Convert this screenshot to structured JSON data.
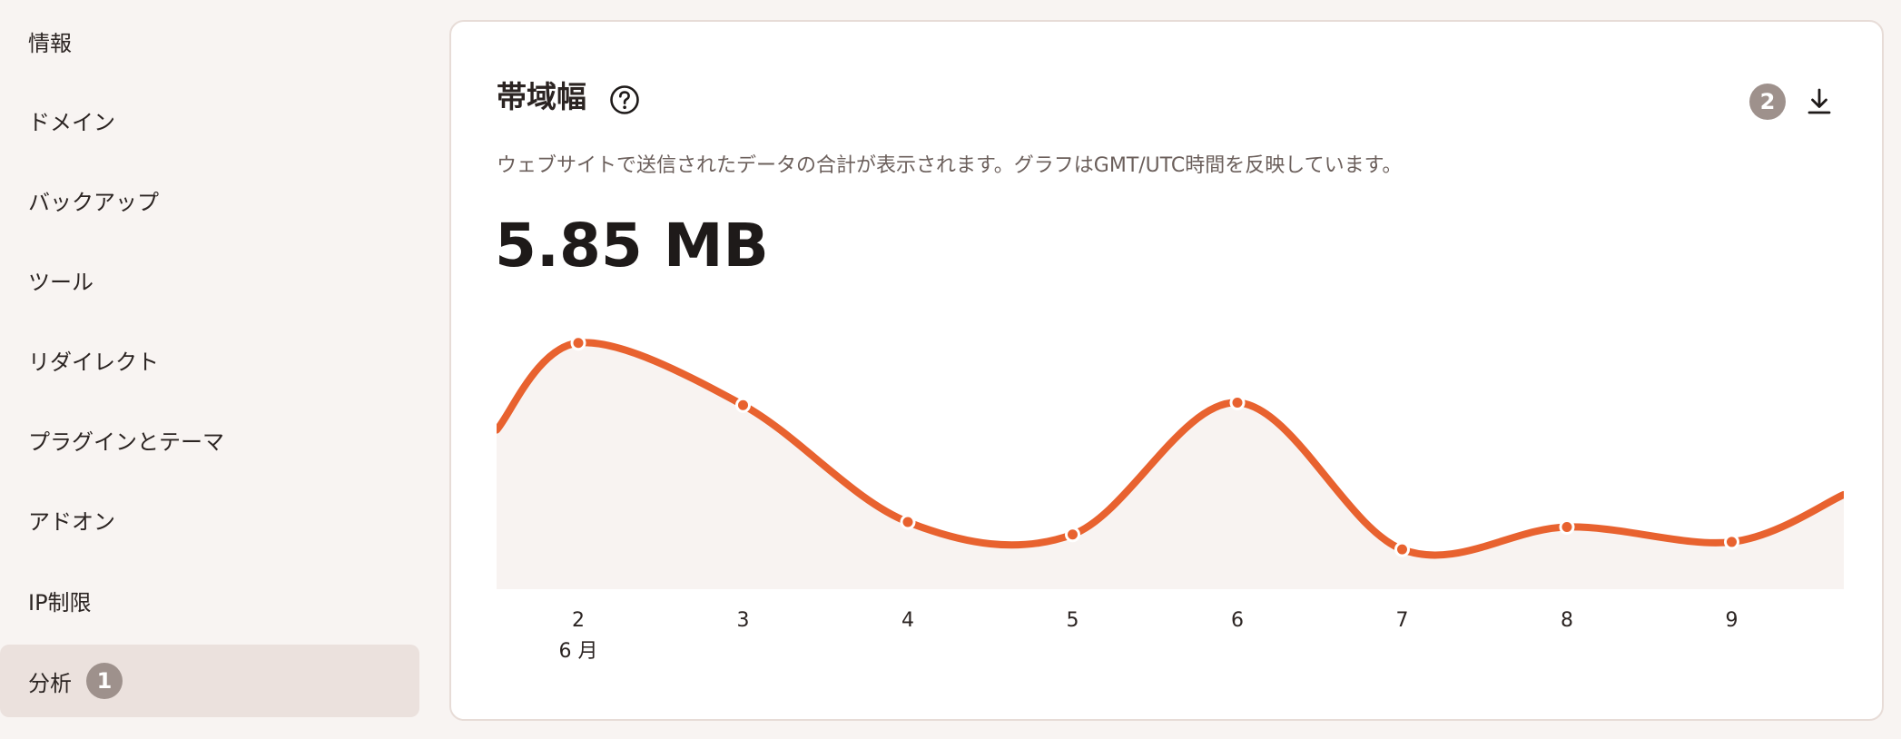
{
  "sidebar": {
    "items": [
      {
        "label": "情報"
      },
      {
        "label": "ドメイン"
      },
      {
        "label": "バックアップ"
      },
      {
        "label": "ツール"
      },
      {
        "label": "リダイレクト"
      },
      {
        "label": "プラグインとテーマ"
      },
      {
        "label": "アドオン"
      },
      {
        "label": "IP制限"
      },
      {
        "label": "分析",
        "badge": "1",
        "active": true
      }
    ]
  },
  "card": {
    "title": "帯域幅",
    "badge": "2",
    "description": "ウェブサイトで送信されたデータの合計が表示されます。グラフはGMT/UTC時間を反映しています。",
    "total": "5.85 MB"
  },
  "colors": {
    "accent": "#e8622f",
    "area_fill": "#f8f3f1",
    "badge": "#9e918c",
    "active_bg": "#ebe1dd"
  },
  "icons": {
    "help": "question-circle-icon",
    "download": "download-icon"
  },
  "chart_data": {
    "type": "area",
    "x": [
      "2",
      "3",
      "4",
      "5",
      "6",
      "7",
      "8",
      "9"
    ],
    "x_sublabel": "6 月",
    "values": [
      0.99,
      0.74,
      0.27,
      0.22,
      0.75,
      0.16,
      0.25,
      0.19
    ],
    "edge_left": 0.64,
    "edge_right": 0.38,
    "ylim": [
      0,
      1.04
    ],
    "title": "",
    "xlabel": "",
    "ylabel": "",
    "grid": false,
    "legend": "none"
  }
}
